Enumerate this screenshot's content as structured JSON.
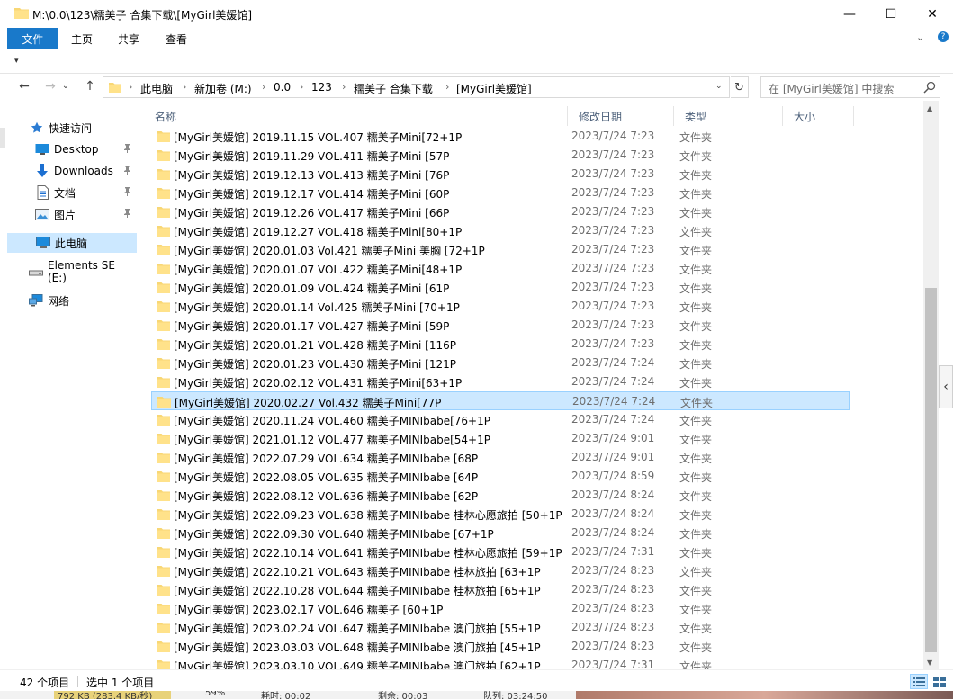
{
  "window": {
    "title": "M:\\0.0\\123\\糯美子 合集下载\\[MyGirl美媛馆]",
    "min_glyph": "—",
    "max_glyph": "☐",
    "close_glyph": "✕"
  },
  "ribbon": {
    "tabs": [
      "文件",
      "主页",
      "共享",
      "查看"
    ],
    "expand_glyph": "⌄",
    "help_glyph": "?"
  },
  "qat": {
    "dropdown_glyph": "▾"
  },
  "nav": {
    "back": "←",
    "forward": "→",
    "dropdown": "⌄",
    "up": "↑",
    "refresh": "↻"
  },
  "address": {
    "crumbs": [
      "此电脑",
      "新加卷 (M:)",
      "0.0",
      "123",
      "糯美子 合集下载",
      "[MyGirl美媛馆]"
    ],
    "separator": "›",
    "dropdown_glyph": "⌄"
  },
  "search": {
    "placeholder": "在 [MyGirl美媛馆] 中搜索"
  },
  "sidebar": {
    "items": [
      {
        "label": "快速访问",
        "icon": "star-icon",
        "pinned": false
      },
      {
        "label": "Desktop",
        "icon": "desktop-icon",
        "pinned": true
      },
      {
        "label": "Downloads",
        "icon": "download-icon",
        "pinned": true
      },
      {
        "label": "文档",
        "icon": "document-icon",
        "pinned": true
      },
      {
        "label": "图片",
        "icon": "picture-icon",
        "pinned": true
      },
      {
        "label": "此电脑",
        "icon": "computer-icon",
        "pinned": false,
        "selected": true
      },
      {
        "label": "Elements SE (E:)",
        "icon": "drive-icon",
        "pinned": false
      },
      {
        "label": "网络",
        "icon": "network-icon",
        "pinned": false
      }
    ],
    "pin_glyph": "📌"
  },
  "columns": {
    "name": "名称",
    "date": "修改日期",
    "type": "类型",
    "size": "大小",
    "sort_glyph": "^"
  },
  "files": [
    {
      "name": "[MyGirl美媛馆] 2019.11.15 VOL.407 糯美子Mini[72+1P",
      "date": "2023/7/24 7:23",
      "type": "文件夹"
    },
    {
      "name": "[MyGirl美媛馆] 2019.11.29 VOL.411 糯美子Mini [57P",
      "date": "2023/7/24 7:23",
      "type": "文件夹"
    },
    {
      "name": "[MyGirl美媛馆] 2019.12.13 VOL.413 糯美子Mini [76P",
      "date": "2023/7/24 7:23",
      "type": "文件夹"
    },
    {
      "name": "[MyGirl美媛馆] 2019.12.17 VOL.414 糯美子Mini [60P",
      "date": "2023/7/24 7:23",
      "type": "文件夹"
    },
    {
      "name": "[MyGirl美媛馆] 2019.12.26 VOL.417 糯美子Mini [66P",
      "date": "2023/7/24 7:23",
      "type": "文件夹"
    },
    {
      "name": "[MyGirl美媛馆] 2019.12.27 VOL.418 糯美子Mini[80+1P",
      "date": "2023/7/24 7:23",
      "type": "文件夹"
    },
    {
      "name": "[MyGirl美媛馆] 2020.01.03 Vol.421 糯美子Mini 美胸 [72+1P",
      "date": "2023/7/24 7:23",
      "type": "文件夹"
    },
    {
      "name": "[MyGirl美媛馆] 2020.01.07 VOL.422 糯美子Mini[48+1P",
      "date": "2023/7/24 7:23",
      "type": "文件夹"
    },
    {
      "name": "[MyGirl美媛馆] 2020.01.09 VOL.424 糯美子Mini [61P",
      "date": "2023/7/24 7:23",
      "type": "文件夹"
    },
    {
      "name": "[MyGirl美媛馆] 2020.01.14 Vol.425 糯美子Mini [70+1P",
      "date": "2023/7/24 7:23",
      "type": "文件夹"
    },
    {
      "name": "[MyGirl美媛馆] 2020.01.17 VOL.427 糯美子Mini [59P",
      "date": "2023/7/24 7:23",
      "type": "文件夹"
    },
    {
      "name": "[MyGirl美媛馆] 2020.01.21 VOL.428 糯美子Mini [116P",
      "date": "2023/7/24 7:23",
      "type": "文件夹"
    },
    {
      "name": "[MyGirl美媛馆] 2020.01.23 VOL.430 糯美子Mini [121P",
      "date": "2023/7/24 7:24",
      "type": "文件夹"
    },
    {
      "name": "[MyGirl美媛馆] 2020.02.12 VOL.431 糯美子Mini[63+1P",
      "date": "2023/7/24 7:24",
      "type": "文件夹"
    },
    {
      "name": "[MyGirl美媛馆] 2020.02.27 Vol.432 糯美子Mini[77P",
      "date": "2023/7/24 7:24",
      "type": "文件夹",
      "selected": true
    },
    {
      "name": "[MyGirl美媛馆] 2020.11.24 VOL.460 糯美子MINIbabe[76+1P",
      "date": "2023/7/24 7:24",
      "type": "文件夹"
    },
    {
      "name": "[MyGirl美媛馆] 2021.01.12 VOL.477 糯美子MINIbabe[54+1P",
      "date": "2023/7/24 9:01",
      "type": "文件夹"
    },
    {
      "name": "[MyGirl美媛馆] 2022.07.29 VOL.634 糯美子MINIbabe [68P",
      "date": "2023/7/24 9:01",
      "type": "文件夹"
    },
    {
      "name": "[MyGirl美媛馆] 2022.08.05 VOL.635 糯美子MINIbabe [64P",
      "date": "2023/7/24 8:59",
      "type": "文件夹"
    },
    {
      "name": "[MyGirl美媛馆] 2022.08.12 VOL.636 糯美子MINIbabe [62P",
      "date": "2023/7/24 8:24",
      "type": "文件夹"
    },
    {
      "name": "[MyGirl美媛馆] 2022.09.23 VOL.638 糯美子MINIbabe 桂林心愿旅拍 [50+1P",
      "date": "2023/7/24 8:24",
      "type": "文件夹"
    },
    {
      "name": "[MyGirl美媛馆] 2022.09.30 VOL.640 糯美子MINIbabe [67+1P",
      "date": "2023/7/24 8:24",
      "type": "文件夹"
    },
    {
      "name": "[MyGirl美媛馆] 2022.10.14 VOL.641 糯美子MINIbabe 桂林心愿旅拍 [59+1P",
      "date": "2023/7/24 7:31",
      "type": "文件夹"
    },
    {
      "name": "[MyGirl美媛馆] 2022.10.21 VOL.643 糯美子MINIbabe 桂林旅拍 [63+1P",
      "date": "2023/7/24 8:23",
      "type": "文件夹"
    },
    {
      "name": "[MyGirl美媛馆] 2022.10.28 VOL.644 糯美子MINIbabe 桂林旅拍 [65+1P",
      "date": "2023/7/24 8:23",
      "type": "文件夹"
    },
    {
      "name": "[MyGirl美媛馆] 2023.02.17 VOL.646 糯美子 [60+1P",
      "date": "2023/7/24 8:23",
      "type": "文件夹"
    },
    {
      "name": "[MyGirl美媛馆] 2023.02.24 VOL.647 糯美子MINIbabe 澳门旅拍 [55+1P",
      "date": "2023/7/24 8:23",
      "type": "文件夹"
    },
    {
      "name": "[MyGirl美媛馆] 2023.03.03 VOL.648 糯美子MINIbabe 澳门旅拍 [45+1P",
      "date": "2023/7/24 8:23",
      "type": "文件夹"
    },
    {
      "name": "[MyGirl美媛馆] 2023.03.10 VOL.649 糯美子MINIbabe 澳门旅拍 [62+1P",
      "date": "2023/7/24 7:31",
      "type": "文件夹"
    }
  ],
  "scrollbar": {
    "up_glyph": "▲",
    "down_glyph": "▼",
    "collapse_glyph": "‹"
  },
  "status": {
    "count": "42 个项目",
    "selected": "选中 1 个项目"
  },
  "underlying": {
    "texts": [
      "792 KB (283.4 KB/秒)",
      "59%",
      "耗时: 00:02",
      "剩余: 00:03",
      "队列: 03:24:50"
    ]
  },
  "colors": {
    "accent": "#1979ca",
    "selection": "#cce8ff",
    "selection_border": "#99d1ff",
    "folder": "#f8d775"
  }
}
